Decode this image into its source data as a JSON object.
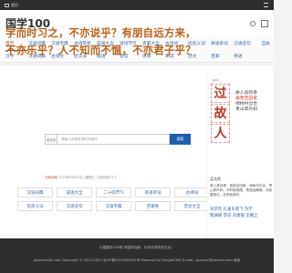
{
  "topbar": {
    "label": "首页"
  },
  "header": {
    "logo": "国学100"
  },
  "nav": {
    "row1": [
      "首页",
      "汉语词典",
      "汉语字典",
      "古诗赏析",
      "成语大全",
      "诗词节气",
      "百家大全",
      "古诗词",
      "近反义词",
      "英语单词",
      "汉语造句",
      "范文大全"
    ],
    "row2": [
      "汉字",
      "汉语词典",
      "古诗文",
      "近义词",
      "成语",
      "造句",
      "诗词",
      "单词",
      "范文",
      "百家",
      "英语",
      "词语"
    ],
    "right": "自关"
  },
  "quote": "学而时习之，不亦说乎？有朋自远方来，不亦乐乎？人不知而不愠，不亦君子乎？",
  "search": {
    "label": "请选择",
    "placeholder": "请输入你想查询的关键词",
    "button": "搜索"
  },
  "date": {
    "prefix": "马到功成",
    "text": "2023年5月31日 | 星期三 | 农历四月十三"
  },
  "grid": [
    [
      "汉语词典",
      "成语大全",
      "二十四节气",
      "英语单词",
      "古诗词"
    ],
    [
      "近反义词",
      "汉语造句",
      "汉语字典",
      "百家姓",
      "范文大全"
    ]
  ],
  "panel": {
    "chars": [
      "过",
      "故",
      "人"
    ],
    "pinyin": [
      "guò",
      "gù",
      "rén"
    ],
    "side": [
      "故人具鸡黍",
      "邀我至田家",
      "绿树村边合",
      "青山郭外斜"
    ],
    "author": "孟浩然",
    "info": "故人具鸡黍，邀我至田家。绿树村边合，青山郭外斜。开轩面场圃，把酒话桑麻。待到重阳日，还来就菊花。",
    "links": [
      "刘宗元 孔雀东南飞 为学",
      "陶渊明 李白 刘禹锡 王羲之"
    ]
  },
  "footer": {
    "line1": "中国国学100网 学国学经典，中华优秀传统文化！",
    "line2": "guoxue100.com Copyright © 2022-2023 京ICP备2022000001号 Powered by DingletCMS E-mail：guoxue@foxmail.com 版权"
  },
  "colors": {
    "accent": "#c0392b",
    "link": "#2b62a8",
    "quote": "#b8621a",
    "button": "#1f5fb0"
  }
}
